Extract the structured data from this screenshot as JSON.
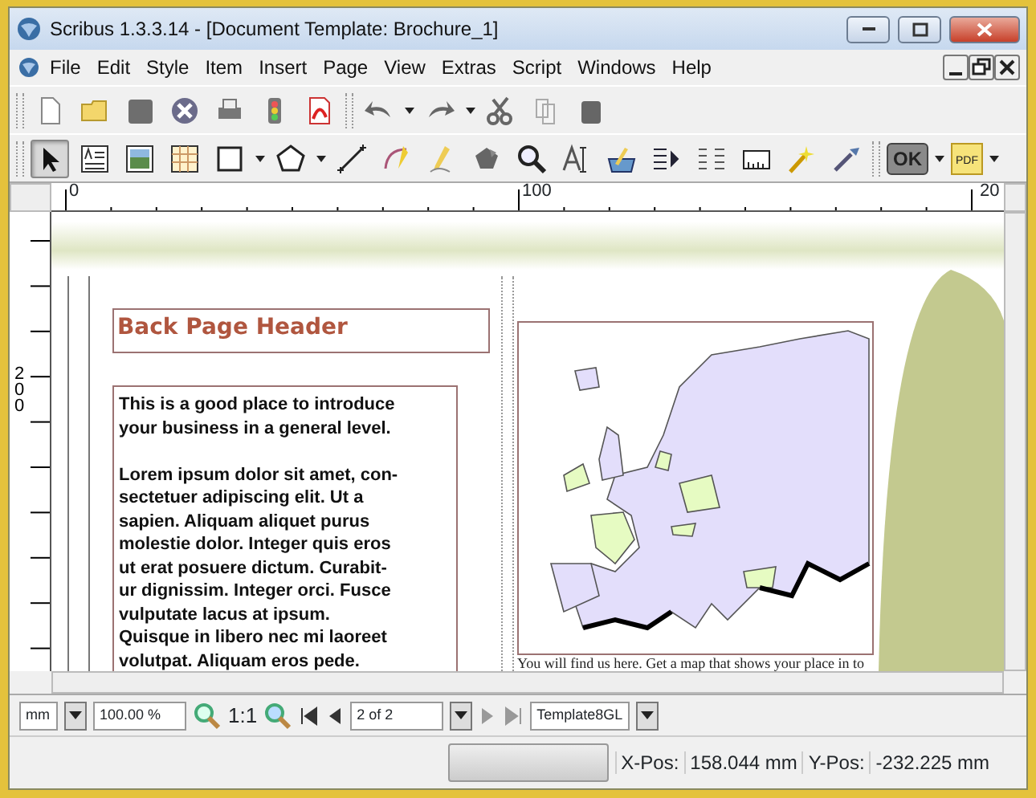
{
  "window": {
    "title": "Scribus 1.3.3.14 - [Document Template: Brochure_1]"
  },
  "menu": [
    "File",
    "Edit",
    "Style",
    "Item",
    "Insert",
    "Page",
    "View",
    "Extras",
    "Script",
    "Windows",
    "Help"
  ],
  "tools": [
    {
      "selected": true
    },
    {
      "selected": false
    },
    {
      "selected": false
    },
    {
      "selected": false
    },
    {
      "selected": false
    },
    {
      "selected": false
    },
    {
      "selected": false
    },
    {
      "selected": false
    },
    {
      "selected": false
    },
    {
      "selected": false
    },
    {
      "selected": false
    },
    {
      "selected": false
    },
    {
      "selected": false
    },
    {
      "selected": false
    },
    {
      "selected": false
    },
    {
      "selected": false
    },
    {
      "selected": false
    },
    {
      "selected": false
    }
  ],
  "quick_buttons": [
    "OK",
    "PDF"
  ],
  "ruler": {
    "top_labels": [
      "0",
      "100",
      "20"
    ],
    "left_label": "200"
  },
  "page": {
    "header": "Back Page Header",
    "paragraphs": [
      [
        "This is a good place to introduce",
        "your business in a general level."
      ],
      [
        "Lorem ipsum dolor sit amet, con-",
        "sectetuer adipiscing elit. Ut a",
        "sapien. Aliquam aliquet purus",
        "molestie dolor. Integer quis eros",
        "ut erat posuere dictum. Curabit-",
        "ur dignissim. Integer orci. Fusce",
        "vulputate lacus at ipsum.",
        "Quisque in libero nec mi laoreet",
        "volutpat. Aliquam eros pede."
      ]
    ],
    "map_caption": "You will find us here. Get a map that shows your place in to"
  },
  "bottom_bar": {
    "unit": "mm",
    "zoom": "100.00 %",
    "actual_size": "1:1",
    "page": "2 of 2",
    "layer": "Template8GL"
  },
  "status_bar": {
    "x_label": "X-Pos:",
    "x_value": "158.044 mm",
    "y_label": "Y-Pos:",
    "y_value": "-232.225 mm"
  }
}
